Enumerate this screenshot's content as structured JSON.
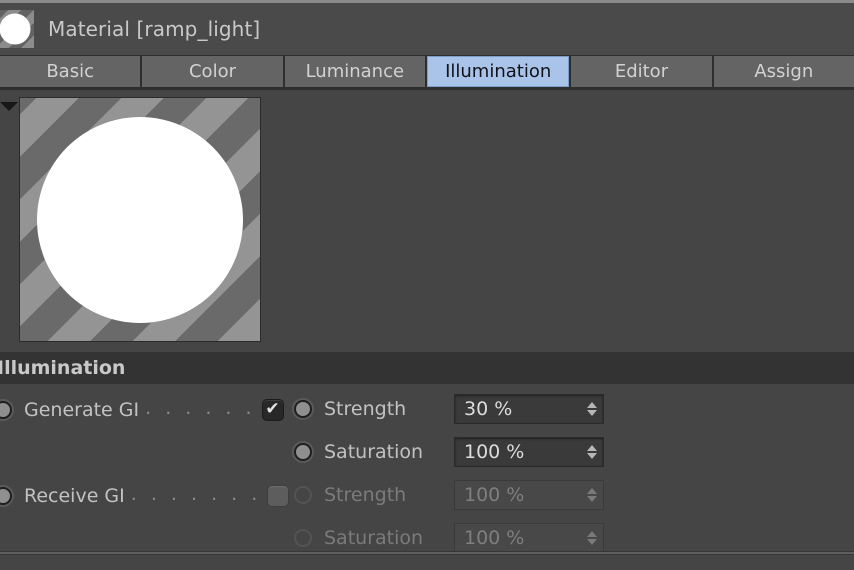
{
  "window": {
    "title": "Material [ramp_light]",
    "thumbnail_icon": "material-sphere-thumbnail"
  },
  "tabs": [
    {
      "label": "Basic",
      "active": false
    },
    {
      "label": "Color",
      "active": false
    },
    {
      "label": "Luminance",
      "active": false
    },
    {
      "label": "Illumination",
      "active": true
    },
    {
      "label": "Editor",
      "active": false
    },
    {
      "label": "Assign",
      "active": false
    }
  ],
  "preview": {
    "disclosure_icon": "triangle-down-icon",
    "swatch_icon": "material-preview-sphere"
  },
  "section": {
    "title": "Illumination"
  },
  "properties": {
    "left_rows": [
      {
        "channel_icon": "channel-toggle-icon",
        "name": "Generate GI",
        "leaders": ". . . . . .",
        "checkbox_icon": "checkbox-checked-icon",
        "checked": true,
        "check_glyph": "✔"
      },
      {
        "channel_icon": "channel-toggle-icon",
        "name": "Receive GI",
        "leaders": ". . . . . . .",
        "checkbox_icon": "checkbox-unchecked-icon",
        "checked": false,
        "check_glyph": ""
      }
    ],
    "right_rows": [
      {
        "channel_icon": "channel-toggle-icon",
        "name": "Strength",
        "value": "30 %",
        "enabled": true,
        "spinner_icon": "spinner-updown-icon"
      },
      {
        "channel_icon": "channel-toggle-icon",
        "name": "Saturation",
        "value": "100 %",
        "enabled": true,
        "spinner_icon": "spinner-updown-icon"
      },
      {
        "channel_icon": "channel-toggle-icon",
        "name": "Strength",
        "value": "100 %",
        "enabled": false,
        "spinner_icon": "spinner-updown-icon"
      },
      {
        "channel_icon": "channel-toggle-icon",
        "name": "Saturation",
        "value": "100 %",
        "enabled": false,
        "spinner_icon": "spinner-updown-icon"
      }
    ]
  },
  "colors": {
    "panel_bg": "#454545",
    "titlebar_bg": "#4a4a4a",
    "tab_bg": "#646464",
    "tab_active_bg": "#a9c4e8",
    "section_header_bg": "#333333",
    "text": "#c9c9c9",
    "text_disabled": "#7b7b7b",
    "field_bg": "#3a3a3a"
  }
}
